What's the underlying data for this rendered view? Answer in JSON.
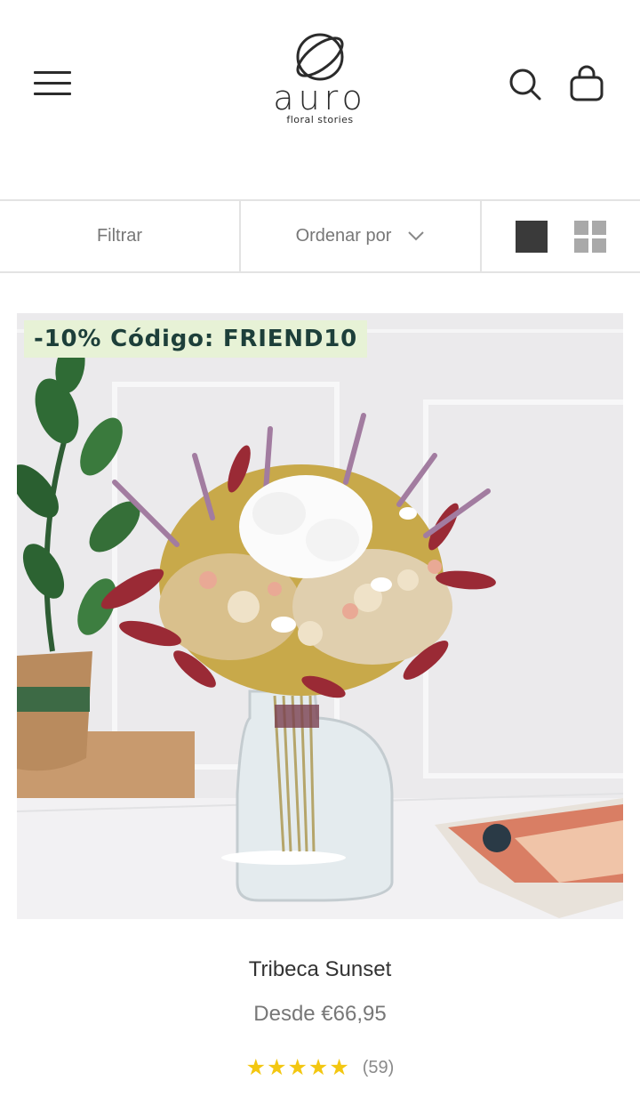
{
  "header": {
    "brand_name": "auro",
    "brand_tagline": "floral stories",
    "menu_icon": "hamburger-icon",
    "search_icon": "search-icon",
    "cart_icon": "shopping-bag-icon"
  },
  "toolbar": {
    "filter_label": "Filtrar",
    "sort_label": "Ordenar por",
    "view_single_icon": "single-view-icon",
    "view_grid_icon": "grid-view-icon"
  },
  "product": {
    "badge": "-10% Código: FRIEND10",
    "name": "Tribeca Sunset",
    "price": "Desde €66,95",
    "rating": 5,
    "stars": "★★★★★",
    "review_count": "(59)"
  },
  "colors": {
    "badge_bg": "#e7f2d6",
    "badge_text": "#1d3f3a",
    "star": "#f3c711",
    "divider": "#e3e3e3"
  }
}
